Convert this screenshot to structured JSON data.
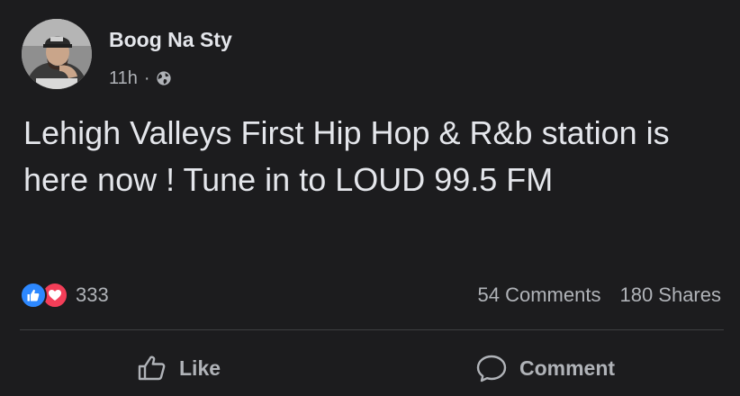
{
  "post": {
    "author": "Boog Na Sty",
    "time": "11h",
    "separator": "·",
    "audience_icon": "globe-icon",
    "text": "Lehigh Valleys First Hip Hop & R&b station is here now ! Tune in to LOUD 99.5 FM"
  },
  "reactions": {
    "icons": [
      "like-reaction-icon",
      "love-reaction-icon"
    ],
    "count": "333"
  },
  "engagement": {
    "comments": "54 Comments",
    "shares": "180 Shares"
  },
  "actions": {
    "like_label": "Like",
    "comment_label": "Comment"
  },
  "colors": {
    "background": "#1c1c1e",
    "primary_text": "#e4e6eb",
    "secondary_text": "#b0b3b8",
    "like_blue": "#2d88ff",
    "love_red": "#f33e58",
    "divider": "#3e4042"
  }
}
